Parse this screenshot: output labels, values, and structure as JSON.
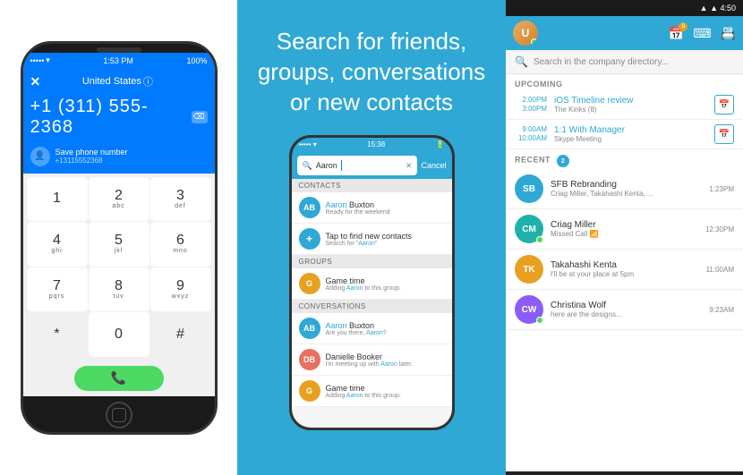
{
  "left_phone": {
    "status_bar": {
      "dots": "•••••",
      "wifi": "WiFi",
      "time": "1:53 PM",
      "battery": "100%"
    },
    "country": "United States",
    "number": "+1 (311) 555-2368",
    "delete_btn": "⌫",
    "save_label": "Save phone number",
    "save_sub": "+13115552368",
    "keys": [
      {
        "num": "1",
        "alpha": ""
      },
      {
        "num": "2",
        "alpha": "abc"
      },
      {
        "num": "3",
        "alpha": "def"
      },
      {
        "num": "4",
        "alpha": "ghi"
      },
      {
        "num": "5",
        "alpha": "jkl"
      },
      {
        "num": "6",
        "alpha": "mno"
      },
      {
        "num": "7",
        "alpha": "pqrs"
      },
      {
        "num": "8",
        "alpha": "tuv"
      },
      {
        "num": "9",
        "alpha": "wxyz"
      },
      {
        "num": "*",
        "alpha": ""
      },
      {
        "num": "0",
        "alpha": ""
      },
      {
        "num": "#",
        "alpha": ""
      }
    ]
  },
  "middle": {
    "headline": "Search for friends, groups, conversations or new contacts",
    "phone": {
      "status_dots": "•••••",
      "status_time": "15:38",
      "search_text": "Aaron",
      "cancel": "Cancel",
      "sections": [
        {
          "header": "Contacts",
          "items": [
            {
              "name": "Aaron Buxton",
              "sub": "Ready for the weekend",
              "highlight": "Aaron"
            },
            {
              "name": "Tap to find new contacts",
              "sub": "Search for \"Aaron\"",
              "icon": "add"
            }
          ]
        },
        {
          "header": "Groups",
          "items": [
            {
              "name": "Game time",
              "sub": "Adding Aaron to this group.",
              "highlight": "Aaron"
            }
          ]
        },
        {
          "header": "Conversations",
          "items": [
            {
              "name": "Aaron Buxton",
              "sub": "Are you there, Aaron?",
              "highlight": "Aaron"
            },
            {
              "name": "Danielle Booker",
              "sub": "I'm meeting up with Aaron later.",
              "highlight": "Aaron"
            },
            {
              "name": "Game time",
              "sub": "Adding Aaron to this group.",
              "highlight": "Aaron"
            }
          ]
        }
      ]
    }
  },
  "right_panel": {
    "status": {
      "wifi": "WiFi",
      "signal": "▲▲▲",
      "time": "4:50",
      "battery_badge": "8"
    },
    "search_placeholder": "Search in the company directory...",
    "upcoming_label": "UPCOMING",
    "upcoming_items": [
      {
        "time_start": "2:00PM",
        "time_end": "3:00PM",
        "title": "iOS Timeline review",
        "sub": "The Kinks (8)"
      },
      {
        "time_start": "9:00AM",
        "time_end": "10:00AM",
        "title": "1:1 With Manager",
        "sub": "Skype Meeting"
      }
    ],
    "recent_label": "RECENT",
    "recent_count": "2",
    "recent_items": [
      {
        "name": "SFB Rebranding",
        "sub": "Criag Miller, Takahashi Kenta, ...",
        "time": "1:23PM",
        "initials": "SB",
        "color": "blue"
      },
      {
        "name": "Criag Miller",
        "sub": "Missed Call 📶",
        "time": "12:30PM",
        "initials": "CM",
        "color": "teal"
      },
      {
        "name": "Takahashi Kenta",
        "sub": "I'll be at your place at 5pm",
        "time": "11:00AM",
        "initials": "TK",
        "color": "orange"
      },
      {
        "name": "Christina Wolf",
        "sub": "here are the designs...",
        "time": "9:23AM",
        "initials": "CW",
        "color": "purple"
      }
    ]
  }
}
